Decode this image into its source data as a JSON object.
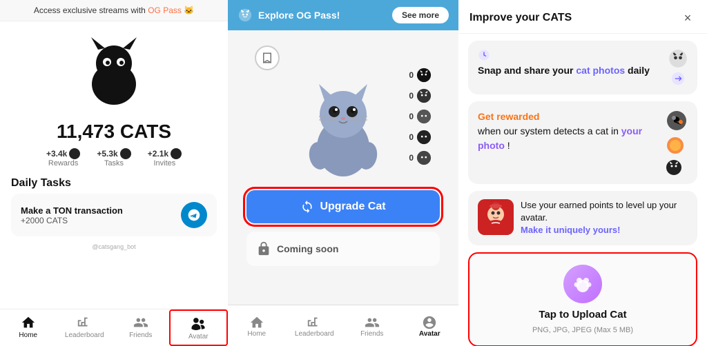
{
  "left_panel": {
    "og_banner": "Access exclusive streams with",
    "og_link": "OG Pass 🐱",
    "cats_count": "11,473 CATS",
    "stats": [
      {
        "label": "Rewards",
        "value": "+3.4k"
      },
      {
        "label": "Tasks",
        "value": "+5.3k"
      },
      {
        "label": "Invites",
        "value": "+2.1k"
      }
    ],
    "daily_tasks_title": "Daily Tasks",
    "tasks": [
      {
        "name": "Make a TON transaction",
        "reward": "+2000 CATS"
      }
    ],
    "nav_items": [
      {
        "label": "Home",
        "active": true
      },
      {
        "label": "Leaderboard",
        "active": false
      },
      {
        "label": "Friends",
        "active": false
      },
      {
        "label": "Avatar",
        "active": false,
        "highlighted": true
      }
    ],
    "bot_label": "@catsgang_bot"
  },
  "middle_panel": {
    "explore_label": "Explore OG Pass!",
    "see_more": "See more",
    "scores": [
      "0",
      "0",
      "0",
      "0",
      "0"
    ],
    "upgrade_btn": "Upgrade Cat",
    "coming_soon": "Coming soon",
    "nav_items": [
      {
        "label": "Home"
      },
      {
        "label": "Leaderboard"
      },
      {
        "label": "Friends"
      },
      {
        "label": "Avatar"
      }
    ]
  },
  "right_panel": {
    "title": "Improve your CATS",
    "close": "×",
    "card1": {
      "heading1": "Snap and share your",
      "heading_blue": "cat photos",
      "heading2": "daily"
    },
    "card2": {
      "text1": "Get rewarded",
      "text2": "when our system detects a cat in",
      "text3": "your photo",
      "text4": "!"
    },
    "card3": {
      "text": "Use your earned points to level up your avatar.",
      "link": "Make it uniquely yours!"
    },
    "upload_card": {
      "title": "Tap to Upload Cat",
      "subtitle": "PNG, JPG, JPEG (Max 5 MB)"
    }
  }
}
